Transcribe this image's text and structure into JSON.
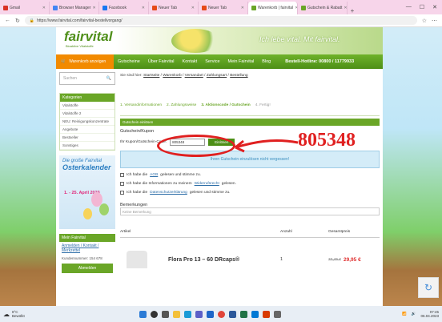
{
  "browser": {
    "tabs": [
      {
        "label": "Gmail",
        "color": "#d93025",
        "active": false
      },
      {
        "label": "Browser Manager",
        "color": "#4285f4",
        "active": false
      },
      {
        "label": "Facebook",
        "color": "#1877f2",
        "active": false
      },
      {
        "label": "Neuer Tab",
        "color": "#e64a19",
        "active": false
      },
      {
        "label": "Neuer Tab",
        "color": "#e64a19",
        "active": false
      },
      {
        "label": "Warenkorb | fairvital",
        "color": "#6aa627",
        "active": true
      },
      {
        "label": "Gutschein & Rabatt",
        "color": "#6aa627",
        "active": false
      }
    ],
    "url": "https://www.fairvital.com/fairvital-bestellvorgang/",
    "window_controls": [
      "—",
      "☐",
      "✕"
    ]
  },
  "site": {
    "logo": "fairvital",
    "logo_sub": "Bioaktive Vitalstoffe",
    "slogan": "Ich lebe vital. Mit fairvital.",
    "cart_label": "Warenkorb anzeigen",
    "nav": [
      "Gutscheine",
      "Über Fairvital",
      "Kontakt",
      "Service",
      "Mein Fairvital",
      "Blog"
    ],
    "hotline": "Bestell-Hotline: 00800 / 11779933"
  },
  "sidebar": {
    "search_placeholder": "Suchen",
    "category_header": "Kategorien",
    "categories": [
      "Vitalstoffe",
      "Vitalstoffe 2",
      "NEU: Reinigungskonzentrate",
      "Angebote",
      "Bestseller",
      "Sonstiges"
    ],
    "promo_line1": "Die große Fairvital",
    "promo_line2": "Osterkalender",
    "promo_date": "1. - 25. April 2023",
    "fav_header": "Mein Fairvital",
    "fav_link": "Anmelden / Kontakt / Merkzettel",
    "fav_count": "Kundennummer: 154 678",
    "fav_button": "Abmelden"
  },
  "main": {
    "breadcrumb_prefix": "Sie sind hier:",
    "breadcrumb": [
      "Startseite",
      "Warenkorb",
      "Versandart",
      "Zahlungsart",
      "Bestellung"
    ],
    "steps": [
      "1. Versandinformationen",
      "2. Zahlungsweise",
      "3. Aktionscode / Gutschein",
      "4. Fertig!"
    ],
    "section_bar": "Gutschein einlösen",
    "coupon_title": "Gutschein/Kupon",
    "coupon_label": "Ihr Kupon/Gutschein-Code:",
    "coupon_value": "805348",
    "redeem_label": "Einlösen",
    "alert_text": "Ihren Gutschein einzulösen nicht vergessen!",
    "checks": [
      {
        "pre": "Ich habe die ",
        "link": "AGB",
        "post": " gelesen und stimme zu."
      },
      {
        "pre": "Ich habe die Informationen zu meinem ",
        "link": "Widerrufsrecht",
        "post": " gelesen."
      },
      {
        "pre": "Ich habe die ",
        "link": "Datenschutzerklärung",
        "post": " gelesen und stimme zu."
      }
    ],
    "remarks_title": "Bemerkungen",
    "remarks_placeholder": "Keine Bemerkung",
    "table_headers": [
      "Artikel",
      "Anzahl",
      "Gesamtpreis"
    ],
    "product_name": "Flora Pro 13 – 60 DRcaps®",
    "product_qty": "1",
    "product_old_price": "33,45 €",
    "product_price": "29,95 €"
  },
  "annotation": {
    "number": "805348",
    "color": "#e02020"
  },
  "taskbar": {
    "weather_temp": "8°C",
    "weather_desc": "Bewölkt",
    "time": "07:45",
    "date": "06.04.2023"
  }
}
